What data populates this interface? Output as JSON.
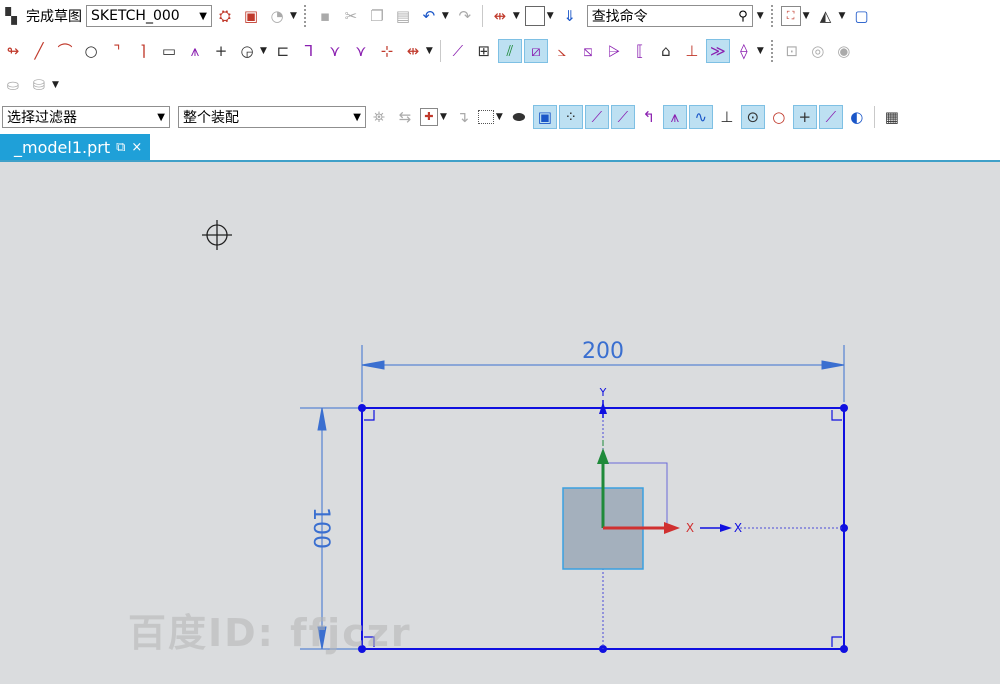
{
  "toolbar_row1": {
    "finish_sketch_label": "完成草图",
    "sketch_name": "SKETCH_000",
    "search_placeholder": "查找命令"
  },
  "selection_bar": {
    "filter_label": "选择过滤器",
    "scope_label": "整个装配"
  },
  "tab": {
    "title": "_model1.prt",
    "close": "×"
  },
  "sketch": {
    "dimension_horizontal": "200",
    "dimension_vertical": "100",
    "axis_y": "Y",
    "axis_x": "X",
    "axis_x2": "X"
  },
  "watermark": "百度ID: ffjczr",
  "colors": {
    "accent": "#1fa0d8",
    "sketch_line": "#1010e0",
    "dimension": "#3a6fd0",
    "canvas": "#dadcde"
  }
}
